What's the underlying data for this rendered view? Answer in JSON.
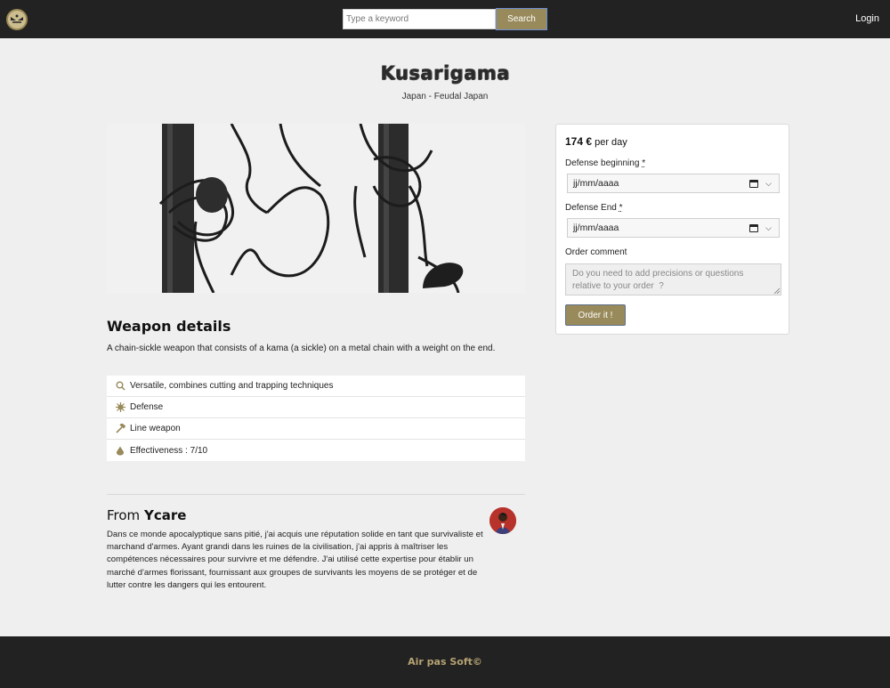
{
  "nav": {
    "search_placeholder": "Type a keyword",
    "search_label": "Search",
    "login_label": "Login"
  },
  "weapon": {
    "name": "Kusarigama",
    "origin": "Japan - Feudal Japan"
  },
  "details": {
    "heading": "Weapon details",
    "description": "A chain-sickle weapon that consists of a kama (a sickle) on a metal chain with a weight on the end.",
    "features": [
      {
        "icon": "search-icon",
        "text": "Versatile, combines cutting and trapping techniques"
      },
      {
        "icon": "virus-icon",
        "text": "Defense"
      },
      {
        "icon": "hammer-icon",
        "text": "Line weapon"
      },
      {
        "icon": "drop-icon",
        "text": "Effectiveness : 7/10"
      }
    ]
  },
  "author": {
    "heading_prefix": "From",
    "name": "Ycare",
    "bio": "Dans ce monde apocalyptique sans pitié, j'ai acquis une réputation solide en tant que survivaliste et marchand d'armes. Ayant grandi dans les ruines de la civilisation, j'ai appris à maîtriser les compétences nécessaires pour survivre et me défendre. J'ai utilisé cette expertise pour établir un marché d'armes florissant, fournissant aux groupes de survivants les moyens de se protéger et de lutter contre les dangers qui les entourent."
  },
  "order": {
    "price": "174 €",
    "per": "per day",
    "begin_label": "Defense beginning",
    "end_label": "Defense End",
    "required_mark": "*",
    "date_placeholder": "jj/mm/aaaa",
    "comment_label": "Order comment",
    "comment_placeholder": "Do you need to add precisions or questions relative to your order  ?",
    "button_label": "Order it !"
  },
  "footer": {
    "brand": "Air pas Soft©"
  },
  "colors": {
    "accent": "#988a5a",
    "dark": "#222222",
    "background": "#efefef"
  }
}
